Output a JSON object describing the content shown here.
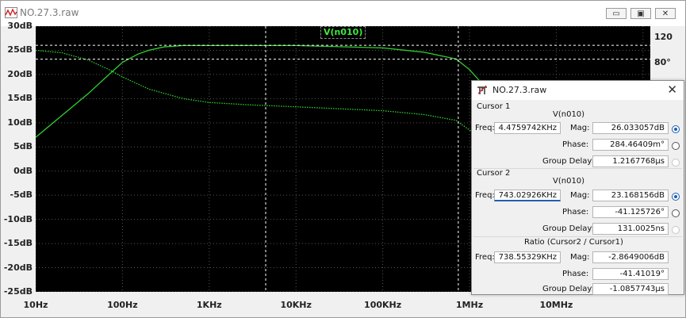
{
  "window": {
    "title": "NO.27.3.raw",
    "minimize_label": "▭",
    "restore_label": "▣",
    "close_label": "✕"
  },
  "plot": {
    "trace_label": "V(n010)",
    "y_left_labels": [
      "30dB",
      "25dB",
      "20dB",
      "15dB",
      "10dB",
      "5dB",
      "0dB",
      "-5dB",
      "-10dB",
      "-15dB",
      "-20dB",
      "-25dB"
    ],
    "y_right_labels": [
      "120°",
      "80°"
    ],
    "x_labels": [
      "10Hz",
      "100Hz",
      "1KHz",
      "10KHz",
      "100KHz",
      "1MHz",
      "10MHz"
    ],
    "colors": {
      "background": "#000000",
      "trace": "#2fd12f",
      "cursor": "#ffffff"
    }
  },
  "chart_data": {
    "type": "line",
    "title": "V(n010)",
    "xscale": "log",
    "xlim_hz": [
      10,
      100000000
    ],
    "ylim_db": [
      -25,
      30
    ],
    "series": [
      {
        "name": "V(n010)",
        "x": [
          10,
          20,
          40,
          70,
          100,
          150,
          200,
          300,
          500,
          1000,
          10000,
          100000,
          300000,
          700000,
          1000000,
          2000000
        ],
        "values": [
          7,
          11.5,
          16,
          20,
          22.5,
          24.2,
          25,
          25.7,
          26,
          26,
          26,
          25.5,
          24.6,
          23.2,
          21,
          15
        ]
      },
      {
        "x": [
          10,
          20,
          40,
          70,
          100,
          200,
          500,
          1000,
          3000,
          10000,
          100000,
          300000,
          700000,
          1000000,
          2000000
        ],
        "values": [
          25,
          24.5,
          23,
          21,
          19.5,
          17,
          15,
          14.2,
          13.7,
          13.3,
          12.5,
          11.7,
          10.5,
          8.5,
          5
        ]
      }
    ],
    "cursors": [
      {
        "x_hz": 4475.9742,
        "y_db": 26.033057
      },
      {
        "x_hz": 743029.26,
        "y_db": 23.168156
      }
    ]
  },
  "dialog": {
    "title": "NO.27.3.raw",
    "close_label": "✕",
    "cursor1": {
      "header": "Cursor 1",
      "signal": "V(n010)",
      "freq_label": "Freq:",
      "freq": "4.4759742KHz",
      "mag_label": "Mag:",
      "mag": "26.033057dB",
      "phase_label": "Phase:",
      "phase": "284.46409m°",
      "gd_label": "Group Delay:",
      "gd": "1.2167768µs"
    },
    "cursor2": {
      "header": "Cursor 2",
      "signal": "V(n010)",
      "freq_label": "Freq:",
      "freq": "743.02926KHz",
      "mag_label": "Mag:",
      "mag": "23.168156dB",
      "phase_label": "Phase:",
      "phase": "-41.125726°",
      "gd_label": "Group Delay:",
      "gd": "131.0025ns"
    },
    "ratio": {
      "header": "Ratio (Cursor2 / Cursor1)",
      "freq_label": "Freq:",
      "freq": "738.55329KHz",
      "mag_label": "Mag:",
      "mag": "-2.8649006dB",
      "phase_label": "Phase:",
      "phase": "-41.41019°",
      "gd_label": "Group Delay:",
      "gd": "-1.0857743µs"
    }
  }
}
